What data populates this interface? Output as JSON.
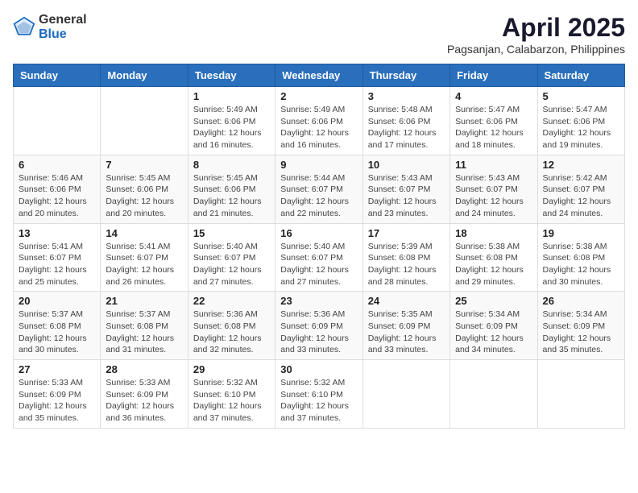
{
  "header": {
    "logo_general": "General",
    "logo_blue": "Blue",
    "title": "April 2025",
    "subtitle": "Pagsanjan, Calabarzon, Philippines"
  },
  "calendar": {
    "days_of_week": [
      "Sunday",
      "Monday",
      "Tuesday",
      "Wednesday",
      "Thursday",
      "Friday",
      "Saturday"
    ],
    "weeks": [
      [
        {
          "day": "",
          "info": ""
        },
        {
          "day": "",
          "info": ""
        },
        {
          "day": "1",
          "info": "Sunrise: 5:49 AM\nSunset: 6:06 PM\nDaylight: 12 hours and 16 minutes."
        },
        {
          "day": "2",
          "info": "Sunrise: 5:49 AM\nSunset: 6:06 PM\nDaylight: 12 hours and 16 minutes."
        },
        {
          "day": "3",
          "info": "Sunrise: 5:48 AM\nSunset: 6:06 PM\nDaylight: 12 hours and 17 minutes."
        },
        {
          "day": "4",
          "info": "Sunrise: 5:47 AM\nSunset: 6:06 PM\nDaylight: 12 hours and 18 minutes."
        },
        {
          "day": "5",
          "info": "Sunrise: 5:47 AM\nSunset: 6:06 PM\nDaylight: 12 hours and 19 minutes."
        }
      ],
      [
        {
          "day": "6",
          "info": "Sunrise: 5:46 AM\nSunset: 6:06 PM\nDaylight: 12 hours and 20 minutes."
        },
        {
          "day": "7",
          "info": "Sunrise: 5:45 AM\nSunset: 6:06 PM\nDaylight: 12 hours and 20 minutes."
        },
        {
          "day": "8",
          "info": "Sunrise: 5:45 AM\nSunset: 6:06 PM\nDaylight: 12 hours and 21 minutes."
        },
        {
          "day": "9",
          "info": "Sunrise: 5:44 AM\nSunset: 6:07 PM\nDaylight: 12 hours and 22 minutes."
        },
        {
          "day": "10",
          "info": "Sunrise: 5:43 AM\nSunset: 6:07 PM\nDaylight: 12 hours and 23 minutes."
        },
        {
          "day": "11",
          "info": "Sunrise: 5:43 AM\nSunset: 6:07 PM\nDaylight: 12 hours and 24 minutes."
        },
        {
          "day": "12",
          "info": "Sunrise: 5:42 AM\nSunset: 6:07 PM\nDaylight: 12 hours and 24 minutes."
        }
      ],
      [
        {
          "day": "13",
          "info": "Sunrise: 5:41 AM\nSunset: 6:07 PM\nDaylight: 12 hours and 25 minutes."
        },
        {
          "day": "14",
          "info": "Sunrise: 5:41 AM\nSunset: 6:07 PM\nDaylight: 12 hours and 26 minutes."
        },
        {
          "day": "15",
          "info": "Sunrise: 5:40 AM\nSunset: 6:07 PM\nDaylight: 12 hours and 27 minutes."
        },
        {
          "day": "16",
          "info": "Sunrise: 5:40 AM\nSunset: 6:07 PM\nDaylight: 12 hours and 27 minutes."
        },
        {
          "day": "17",
          "info": "Sunrise: 5:39 AM\nSunset: 6:08 PM\nDaylight: 12 hours and 28 minutes."
        },
        {
          "day": "18",
          "info": "Sunrise: 5:38 AM\nSunset: 6:08 PM\nDaylight: 12 hours and 29 minutes."
        },
        {
          "day": "19",
          "info": "Sunrise: 5:38 AM\nSunset: 6:08 PM\nDaylight: 12 hours and 30 minutes."
        }
      ],
      [
        {
          "day": "20",
          "info": "Sunrise: 5:37 AM\nSunset: 6:08 PM\nDaylight: 12 hours and 30 minutes."
        },
        {
          "day": "21",
          "info": "Sunrise: 5:37 AM\nSunset: 6:08 PM\nDaylight: 12 hours and 31 minutes."
        },
        {
          "day": "22",
          "info": "Sunrise: 5:36 AM\nSunset: 6:08 PM\nDaylight: 12 hours and 32 minutes."
        },
        {
          "day": "23",
          "info": "Sunrise: 5:36 AM\nSunset: 6:09 PM\nDaylight: 12 hours and 33 minutes."
        },
        {
          "day": "24",
          "info": "Sunrise: 5:35 AM\nSunset: 6:09 PM\nDaylight: 12 hours and 33 minutes."
        },
        {
          "day": "25",
          "info": "Sunrise: 5:34 AM\nSunset: 6:09 PM\nDaylight: 12 hours and 34 minutes."
        },
        {
          "day": "26",
          "info": "Sunrise: 5:34 AM\nSunset: 6:09 PM\nDaylight: 12 hours and 35 minutes."
        }
      ],
      [
        {
          "day": "27",
          "info": "Sunrise: 5:33 AM\nSunset: 6:09 PM\nDaylight: 12 hours and 35 minutes."
        },
        {
          "day": "28",
          "info": "Sunrise: 5:33 AM\nSunset: 6:09 PM\nDaylight: 12 hours and 36 minutes."
        },
        {
          "day": "29",
          "info": "Sunrise: 5:32 AM\nSunset: 6:10 PM\nDaylight: 12 hours and 37 minutes."
        },
        {
          "day": "30",
          "info": "Sunrise: 5:32 AM\nSunset: 6:10 PM\nDaylight: 12 hours and 37 minutes."
        },
        {
          "day": "",
          "info": ""
        },
        {
          "day": "",
          "info": ""
        },
        {
          "day": "",
          "info": ""
        }
      ]
    ]
  }
}
